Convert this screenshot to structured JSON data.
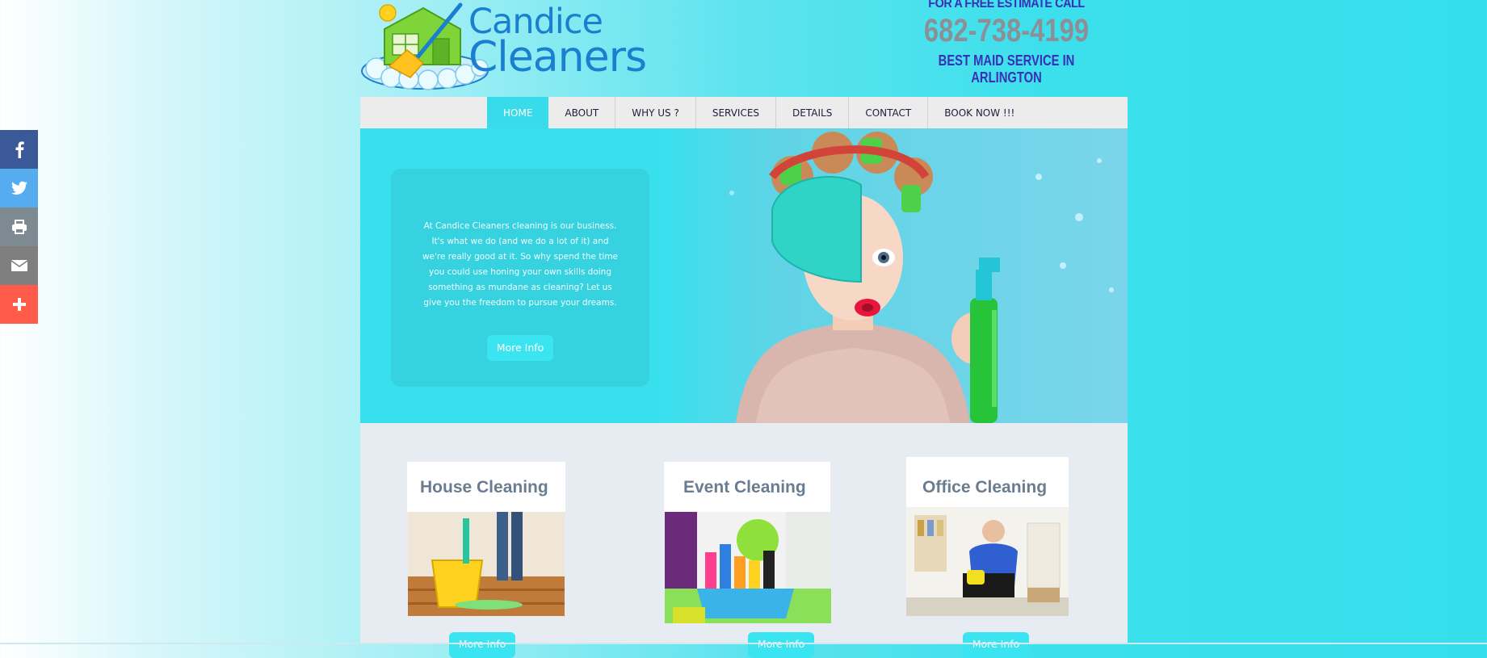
{
  "logo": {
    "line1": "Candice",
    "line2": "Cleaners"
  },
  "header": {
    "estimate_label": "FOR A FREE ESTIMATE CALL",
    "phone": "682-738-4199",
    "tagline": "BEST MAID SERVICE IN ARLINGTON"
  },
  "nav": {
    "items": [
      {
        "label": "HOME",
        "active": true
      },
      {
        "label": "ABOUT"
      },
      {
        "label": "WHY US ?"
      },
      {
        "label": "SERVICES"
      },
      {
        "label": "DETAILS"
      },
      {
        "label": "CONTACT"
      },
      {
        "label": "BOOK NOW !!!"
      }
    ]
  },
  "hero": {
    "text": "At Candice Cleaners cleaning is our business. It's what we do (and we do a lot of it) and we're really good at it. So why spend the time you could use honing your own skills doing something as mundane as cleaning? Let us give you the freedom to pursue your dreams.",
    "button_label": "More Info"
  },
  "services": [
    {
      "title": "House Cleaning",
      "button_label": "More Info"
    },
    {
      "title": "Event Cleaning",
      "button_label": "More Info"
    },
    {
      "title": "Office Cleaning",
      "button_label": "More Info"
    }
  ],
  "social": [
    {
      "icon": "facebook-icon",
      "color": "#3b5998"
    },
    {
      "icon": "twitter-icon",
      "color": "#55acee"
    },
    {
      "icon": "print-icon",
      "color": "#7d8a91"
    },
    {
      "icon": "email-icon",
      "color": "#7f7f7f"
    },
    {
      "icon": "plus-icon",
      "color": "#ff5a4a"
    }
  ],
  "colors": {
    "accent": "#38e0ee",
    "nav_active": "#38dbe9",
    "brand_blue": "#1b7fd0",
    "header_purple": "#3a2fb8",
    "phone_gray": "#8d8f96",
    "services_bg": "#e6ecf1"
  }
}
